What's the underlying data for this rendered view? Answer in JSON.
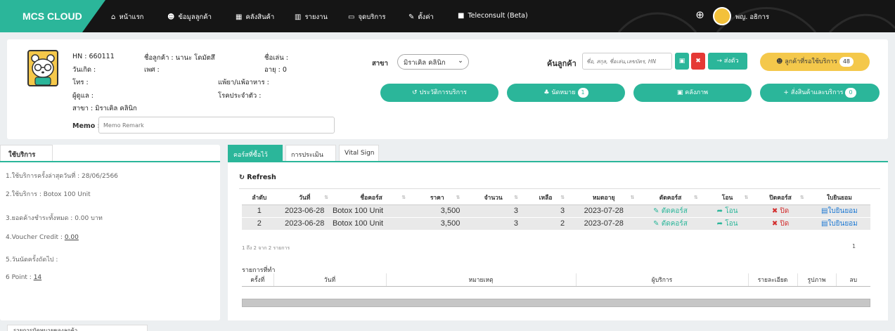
{
  "nav": {
    "brand": "MCS CLOUD",
    "items": [
      {
        "icon": "home-icon",
        "glyph": "⌂",
        "label": "หน้าแรก"
      },
      {
        "icon": "users-icon",
        "glyph": "👥",
        "label": "ข้อมูลลูกค้า"
      },
      {
        "icon": "inventory-icon",
        "glyph": "▦",
        "label": "คลังสินค้า"
      },
      {
        "icon": "report-icon",
        "glyph": "📊",
        "label": "รายงาน"
      },
      {
        "icon": "monitor-icon",
        "glyph": "🖵",
        "label": "จุดบริการ"
      },
      {
        "icon": "wrench-icon",
        "glyph": "🔧",
        "label": "ตั้งค่า"
      },
      {
        "icon": "video-icon",
        "glyph": "■",
        "label": "Teleconsult (Beta)"
      }
    ],
    "user": "พญ. อธิการ"
  },
  "patient": {
    "hn": "HN : 660111",
    "name_label": "ชื่อลูกค้า : นานะ โดมัตสึ",
    "nickname_label": "ชื่อเล่น :",
    "birthday_label": "วันเกิด :",
    "sex_label": "เพศ :",
    "age_label": "อายุ : 0",
    "phone_label": "โทร :",
    "allergy_label": "แพ้ยา/แพ้อาหาร :",
    "caretaker_label": "ผู้ดูแล :",
    "disease_label": "โรคประจำตัว :",
    "branch_label": "สาขา : มิราเคิล คลินิก",
    "memo_label": "Memo :",
    "memo_placeholder": "Memo Remark"
  },
  "branch_select": {
    "label": "สาขา",
    "value": "มิราเคิล คลินิก"
  },
  "search": {
    "label": "ค้นลูกค้า",
    "placeholder": "ชื่อ, สกุล, ชื่อเล่น,เลขบัตร, HN",
    "queue_label": "→ ส่งตัว"
  },
  "waiting_button": {
    "label": "ลูกค้าที่รอใช้บริการ",
    "count": "48"
  },
  "actions": [
    {
      "label": "ประวัติการบริการ",
      "badge": ""
    },
    {
      "label": "นัดหมาย",
      "badge": "1"
    },
    {
      "label": "คลังภาพ",
      "badge": ""
    },
    {
      "label": "สั่งสินค้าและบริการ",
      "badge": "0"
    }
  ],
  "service_panel": {
    "tab": "ใช้บริการ",
    "items": [
      {
        "text": "1.ใช้บริการครั้งล่าสุดวันที่ : 28/06/2566",
        "link": ""
      },
      {
        "text": "2.ใช้บริการ : Botox 100 Unit",
        "link": ""
      },
      {
        "text": "3.ยอดค้างชำระทั้งหมด : 0.00 บาท",
        "link": ""
      },
      {
        "text": "4.Voucher Credit : ",
        "link": "0.00"
      },
      {
        "text": "5.วันนัดครั้งถัดไป :",
        "link": ""
      },
      {
        "text": "6 Point : ",
        "link": "14"
      }
    ]
  },
  "right_tabs": [
    "คอร์สที่ซื้อไว้",
    "การประเมิน",
    "Vital Sign"
  ],
  "refresh_label": "Refresh",
  "course_table": {
    "headers": [
      "ลำดับ",
      "วันที่",
      "ชื่อคอร์ส",
      "ราคา",
      "จำนวน",
      "เหลือ",
      "หมดอายุ",
      "ตัดคอร์ส",
      "โอน",
      "ปิดคอร์ส",
      "ใบยินยอม"
    ],
    "rows": [
      {
        "no": "1",
        "date": "2023-06-28",
        "course": "Botox 100 Unit",
        "price": "3,500",
        "qty": "3",
        "left": "3",
        "expire": "2023-07-28",
        "cut": "ตัดคอร์ส",
        "transfer": "โอน",
        "close": "ปิด",
        "consent": "ใบยินยอม"
      },
      {
        "no": "2",
        "date": "2023-06-28",
        "course": "Botox 100 Unit",
        "price": "3,500",
        "qty": "3",
        "left": "2",
        "expire": "2023-07-28",
        "cut": "ตัดคอร์ส",
        "transfer": "โอน",
        "close": "ปิด",
        "consent": "ใบยินยอม"
      }
    ],
    "paging_info": "1 ถึง 2 จาก 2 รายการ",
    "page": "1"
  },
  "history": {
    "title": "รายการที่ทำ",
    "headers": [
      "ครั้งที่",
      "วันที่",
      "หมายเหตุ",
      "ผู้บริการ",
      "รายละเอียด",
      "รูปภาพ",
      "ลบ"
    ]
  },
  "bottom_tab": "รายการนัดหมายของลูกค้า",
  "colors": {
    "accent": "#2bb69a",
    "nav": "#151515",
    "warning": "#f4c84b",
    "danger": "#e53935"
  }
}
